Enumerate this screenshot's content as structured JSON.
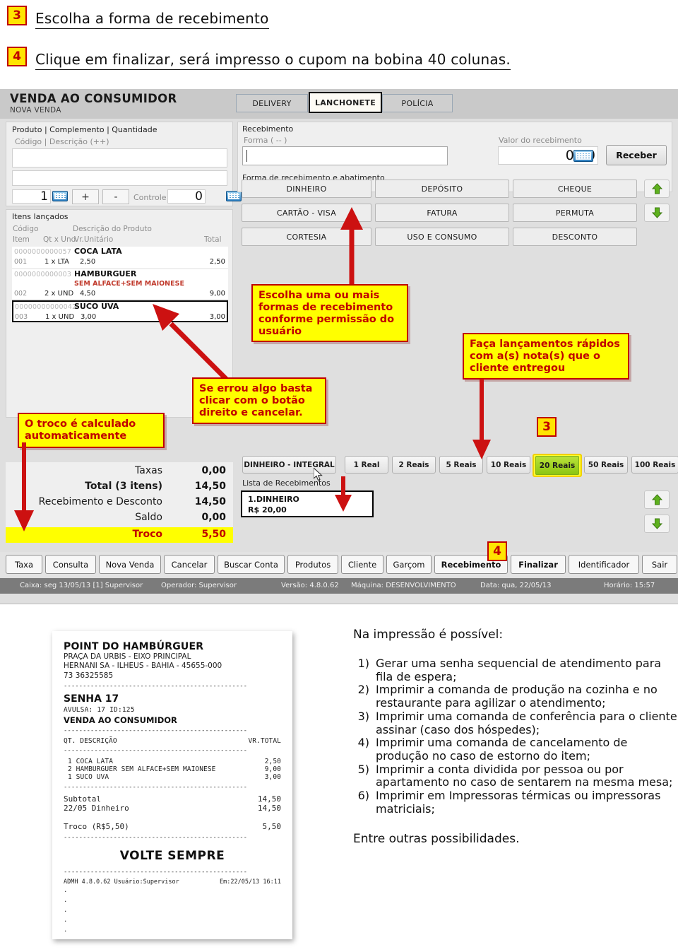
{
  "instructions": [
    {
      "num": "3",
      "text": "Escolha a forma de recebimento"
    },
    {
      "num": "4",
      "text": "Clique em finalizar, será impresso o cupom na bobina 40 colunas."
    }
  ],
  "app": {
    "title": "VENDA AO CONSUMIDOR",
    "subtitle": "NOVA VENDA",
    "tabs": [
      {
        "label": "DELIVERY",
        "active": false
      },
      {
        "label": "LANCHONETE",
        "active": true
      },
      {
        "label": "POLÍCIA",
        "active": false
      }
    ],
    "product_panel": {
      "group_label": "Produto | Complemento | Quantidade",
      "sub_label": "Código | Descrição (++)",
      "input_value": "",
      "complement_value": "",
      "qty_value": "1",
      "plus_label": "+",
      "minus_label": "-",
      "controle_label": "Controle",
      "controle_value": "0"
    },
    "items_panel": {
      "group_label": "Itens lançados",
      "header_line1": [
        "Código",
        "Descrição do Produto"
      ],
      "header_line2": [
        "Item",
        "Qt x Und.",
        "Vr.Unitário",
        "Total"
      ],
      "rows": [
        {
          "code": "0000000000057",
          "name": "COCA LATA",
          "complement": "",
          "item": "001",
          "qty": "1 x LTA",
          "unit": "2,50",
          "total": "2,50",
          "selected": false
        },
        {
          "code": "0000000000003",
          "name": "HAMBURGUER",
          "complement": "SEM ALFACE+SEM MAIONESE",
          "item": "002",
          "qty": "2 x UND",
          "unit": "4,50",
          "total": "9,00",
          "selected": false
        },
        {
          "code": "00000000000042",
          "name": "SUCO UVA",
          "complement": "",
          "item": "003",
          "qty": "1 x UND",
          "unit": "3,00",
          "total": "3,00",
          "selected": true
        }
      ]
    },
    "totals": [
      {
        "label": "Taxas",
        "value": "0,00",
        "bold_label": false,
        "highlight": false
      },
      {
        "label": "Total (3 itens)",
        "value": "14,50",
        "bold_label": true,
        "highlight": false
      },
      {
        "label": "Recebimento e Desconto",
        "value": "14,50",
        "bold_label": false,
        "highlight": false
      },
      {
        "label": "Saldo",
        "value": "0,00",
        "bold_label": false,
        "highlight": false
      },
      {
        "label": "Troco",
        "value": "5,50",
        "bold_label": true,
        "highlight": true
      }
    ],
    "recebimento": {
      "group_label": "Recebimento",
      "forma_label": "Forma ( -- )",
      "forma_value": "",
      "valor_label": "Valor do recebimento",
      "valor_value": "0,00",
      "receber_label": "Receber",
      "formas_label": "Forma de recebimento e abatimento",
      "payment_buttons": [
        "DINHEIRO",
        "DEPÓSITO",
        "CHEQUE",
        "CARTÃO - VISA",
        "FATURA",
        "PERMUTA",
        "CORTESIA",
        "USO E CONSUMO",
        "DESCONTO"
      ],
      "cash_buttons": [
        {
          "label": "DINHEIRO - INTEGRAL",
          "highlight": false
        },
        {
          "label": "1 Real",
          "highlight": false
        },
        {
          "label": "2 Reais",
          "highlight": false
        },
        {
          "label": "5 Reais",
          "highlight": false
        },
        {
          "label": "10 Reais",
          "highlight": false
        },
        {
          "label": "20 Reais",
          "highlight": true
        },
        {
          "label": "50 Reais",
          "highlight": false
        },
        {
          "label": "100 Reais",
          "highlight": false
        }
      ],
      "lista_label": "Lista de Recebimentos",
      "lista_items": [
        {
          "line1": "1.DINHEIRO",
          "line2": "R$ 20,00"
        }
      ]
    },
    "toolbar": [
      {
        "label": "Taxa",
        "accel": "T",
        "bold": false
      },
      {
        "label": "Consulta",
        "accel": "o",
        "bold": false
      },
      {
        "label": "Nova Venda",
        "accel": "N",
        "bold": false
      },
      {
        "label": "Cancelar",
        "accel": "C",
        "bold": false
      },
      {
        "label": "Buscar Conta",
        "accel": "B",
        "bold": false
      },
      {
        "label": "Produtos",
        "accel": "P",
        "bold": false
      },
      {
        "label": "Cliente",
        "accel": "e",
        "bold": false
      },
      {
        "label": "Garçom",
        "accel": "G",
        "bold": false
      },
      {
        "label": "Recebimento",
        "accel": "R",
        "bold": true
      },
      {
        "label": "Finalizar",
        "accel": "F",
        "bold": true
      },
      {
        "label": "Identificador",
        "accel": "I",
        "bold": false
      },
      {
        "label": "Sair",
        "accel": "S",
        "bold": false
      }
    ],
    "statusbar": [
      "Caixa:  seg 13/05/13 [1] Supervisor",
      "Operador:  Supervisor",
      "Versão:  4.8.0.62",
      "Máquina:  DESENVOLVIMENTO",
      "Data:  qua, 22/05/13",
      "Horário:  15:57"
    ]
  },
  "callouts": [
    {
      "id": "formas",
      "text": "Escolha uma ou mais formas de recebimento conforme permissão do usuário"
    },
    {
      "id": "cancelar",
      "text": "Se errou algo basta clicar com o botão direito e cancelar."
    },
    {
      "id": "troco",
      "text": "O troco é calculado automaticamente"
    },
    {
      "id": "lancamentos",
      "text": "Faça lançamentos rápidos com a(s) nota(s) que o cliente entregou"
    }
  ],
  "step_markers": [
    {
      "num": "3"
    },
    {
      "num": "4"
    }
  ],
  "receipt": {
    "store_name": "POINT DO HAMBÚRGUER",
    "address_lines": [
      "PRAÇA DA URBIS - EIXO PRINCIPAL",
      "HERNANI SA - ILHEUS - BAHIA - 45655-000",
      "73 36325585"
    ],
    "senha": "SENHA 17",
    "avulsa": "AVULSA: 17  ID:125",
    "doc_type": "VENDA AO CONSUMIDOR",
    "col_qt": "QT. DESCRIÇÃO",
    "col_total": "VR.TOTAL",
    "items": [
      {
        "text": "1 COCA LATA",
        "value": "2,50"
      },
      {
        "text": "2 HAMBURGUER SEM ALFACE+SEM MAIONESE",
        "value": "9,00"
      },
      {
        "text": "1 SUCO UVA",
        "value": "3,00"
      }
    ],
    "subtotal": {
      "label": "Subtotal",
      "value": "14,50"
    },
    "payment": {
      "label": "22/05 Dinheiro",
      "value": "14,50"
    },
    "troco": {
      "label": "Troco (R$5,50)",
      "value": "5,50"
    },
    "closing": "VOLTE SEMPRE",
    "footer_left": "ADMH 4.8.0.62  Usuário:Supervisor",
    "footer_right": "Em:22/05/13 16:11",
    "separator": "------------------------------------------------"
  },
  "right_text": {
    "heading": "Na impressão é possível:",
    "items": [
      {
        "num": "1)",
        "text": "Gerar uma senha sequencial de atendimento para fila de espera;"
      },
      {
        "num": "2)",
        "text": "Imprimir a comanda de produção na cozinha e no restaurante para agilizar o atendimento;"
      },
      {
        "num": "3)",
        "text": "Imprimir uma comanda de conferência para o cliente assinar (caso dos hóspedes);"
      },
      {
        "num": "4)",
        "text": "Imprimir uma comanda de cancelamento de produção no caso de estorno do item;"
      },
      {
        "num": "5)",
        "text": "Imprimir a conta dividida por pessoa ou por apartamento no caso de sentarem na mesma mesa;"
      },
      {
        "num": "6)",
        "text": "Imprimir em Impressoras térmicas ou impressoras matriciais;"
      }
    ],
    "footer": "Entre outras possibilidades."
  },
  "colors": {
    "callout_bg": "#ffff00",
    "callout_border": "#c00000",
    "callout_text": "#c00000",
    "highlight_green": "#8cc611",
    "troco_row": "#ffff00"
  }
}
